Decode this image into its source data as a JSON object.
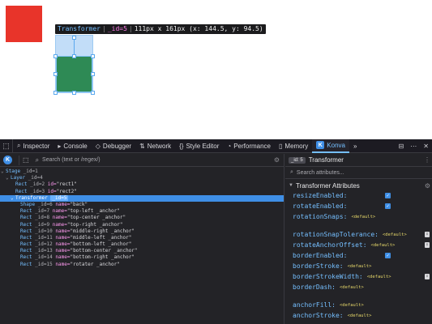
{
  "canvas": {
    "tooltip": {
      "node_name": "Transformer",
      "sep1": "|",
      "node_id": "_id=5",
      "sep2": "|",
      "dims": "111px x 161px (x: 144.5, y: 94.5)"
    },
    "colors": {
      "red_rect": "#e8342a",
      "green_rect": "#2e8a55",
      "transformer": "#5aa8ee"
    }
  },
  "toolbar": {
    "tabs": [
      {
        "icon": "inspector-icon",
        "label": "Inspector"
      },
      {
        "icon": "console-icon",
        "label": "Console"
      },
      {
        "icon": "debugger-icon",
        "label": "Debugger"
      },
      {
        "icon": "network-icon",
        "label": "Network"
      },
      {
        "icon": "style-editor-icon",
        "label": "Style Editor"
      },
      {
        "icon": "performance-icon",
        "label": "Performance"
      },
      {
        "icon": "memory-icon",
        "label": "Memory"
      },
      {
        "icon": "konva-icon",
        "label": "Konva"
      }
    ],
    "active_tab": "Konva",
    "overflow_label": "»"
  },
  "tree": {
    "search_placeholder": "Search (text or /regex/)",
    "rows": [
      {
        "twisty": "⌄",
        "name": "Stage",
        "id": "_id=1"
      },
      {
        "twisty": "⌄",
        "name": "Layer",
        "id": "_id=4"
      },
      {
        "twisty": "",
        "name": "Rect",
        "id": "_id=2",
        "attr": "id=",
        "val": "\"rect1\""
      },
      {
        "twisty": "",
        "name": "Rect",
        "id": "_id=3",
        "attr": "id=",
        "val": "\"rect2\""
      },
      {
        "twisty": "⌄",
        "name": "Transformer",
        "id": "_id=5",
        "selected": true
      },
      {
        "twisty": "",
        "name": "Shape",
        "id": "_id=6",
        "attr": "name=",
        "val": "\"back\""
      },
      {
        "twisty": "",
        "name": "Rect",
        "id": "_id=7",
        "attr": "name=",
        "val": "\"top-left _anchor\""
      },
      {
        "twisty": "",
        "name": "Rect",
        "id": "_id=8",
        "attr": "name=",
        "val": "\"top-center _anchor\""
      },
      {
        "twisty": "",
        "name": "Rect",
        "id": "_id=9",
        "attr": "name=",
        "val": "\"top-right _anchor\""
      },
      {
        "twisty": "",
        "name": "Rect",
        "id": "_id=10",
        "attr": "name=",
        "val": "\"middle-right _anchor\""
      },
      {
        "twisty": "",
        "name": "Rect",
        "id": "_id=11",
        "attr": "name=",
        "val": "\"middle-left _anchor\""
      },
      {
        "twisty": "",
        "name": "Rect",
        "id": "_id=12",
        "attr": "name=",
        "val": "\"bottom-left _anchor\""
      },
      {
        "twisty": "",
        "name": "Rect",
        "id": "_id=13",
        "attr": "name=",
        "val": "\"bottom-center _anchor\""
      },
      {
        "twisty": "",
        "name": "Rect",
        "id": "_id=14",
        "attr": "name=",
        "val": "\"bottom-right _anchor\""
      },
      {
        "twisty": "",
        "name": "Rect",
        "id": "_id=15",
        "attr": "name=",
        "val": "\"rotater _anchor\""
      }
    ]
  },
  "attributes": {
    "header_badge": "_id: 5",
    "header_title": "Transformer",
    "search_placeholder": "Search attributes...",
    "section_title": "Transformer Attributes",
    "rows": [
      {
        "key": "resizeEnabled:",
        "type": "checkbox",
        "checked": true
      },
      {
        "key": "rotateEnabled:",
        "type": "checkbox",
        "checked": true
      },
      {
        "key": "rotationSnaps:",
        "type": "default",
        "default": "<default>"
      },
      {
        "key": "",
        "type": "spacer"
      },
      {
        "key": "rotationSnapTolerance:",
        "type": "stepper",
        "default": "<default>"
      },
      {
        "key": "rotateAnchorOffset:",
        "type": "stepper",
        "default": "<default>"
      },
      {
        "key": "borderEnabled:",
        "type": "checkbox",
        "checked": true
      },
      {
        "key": "borderStroke:",
        "type": "default",
        "default": "<default>"
      },
      {
        "key": "borderStrokeWidth:",
        "type": "stepper",
        "default": "<default>"
      },
      {
        "key": "borderDash:",
        "type": "default",
        "default": "<default>"
      },
      {
        "key": "",
        "type": "spacer"
      },
      {
        "key": "anchorFill:",
        "type": "default",
        "default": "<default>"
      },
      {
        "key": "anchorStroke:",
        "type": "default",
        "default": "<default>"
      }
    ]
  }
}
